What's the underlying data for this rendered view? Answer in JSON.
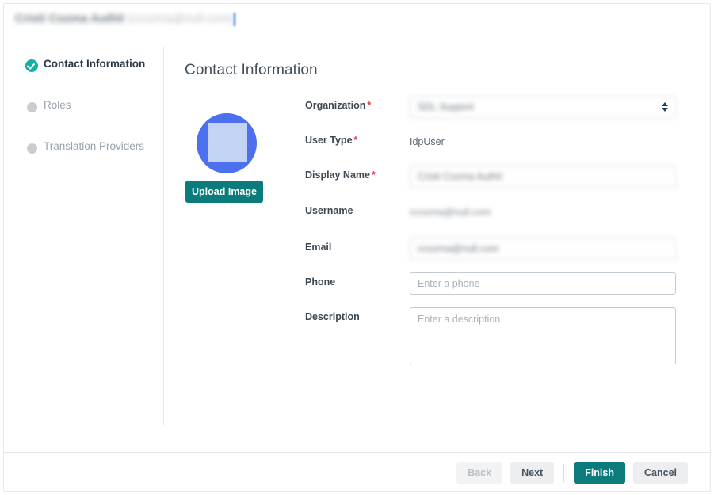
{
  "dialog": {
    "title_name": "Cristi Cozma Auth0",
    "title_email": "(ccozma@null.com)"
  },
  "stepper": {
    "steps": [
      {
        "label": "Contact Information",
        "state": "done"
      },
      {
        "label": "Roles",
        "state": "todo"
      },
      {
        "label": "Translation Providers",
        "state": "todo"
      }
    ]
  },
  "main": {
    "panel_title": "Contact Information",
    "avatar": {
      "upload_label": "Upload Image"
    },
    "form": {
      "organization": {
        "label": "Organization",
        "required": "*",
        "value": "SDL Support"
      },
      "user_type": {
        "label": "User Type",
        "required": "*",
        "value": "IdpUser"
      },
      "display_name": {
        "label": "Display Name",
        "required": "*",
        "value": "Cristi Cozma Auth0"
      },
      "username": {
        "label": "Username",
        "value": "ccozma@null.com"
      },
      "email": {
        "label": "Email",
        "value": "ccozma@null.com"
      },
      "phone": {
        "label": "Phone",
        "value": "",
        "placeholder": "Enter a phone"
      },
      "description": {
        "label": "Description",
        "value": "",
        "placeholder": "Enter a description"
      }
    }
  },
  "footer": {
    "back_label": "Back",
    "next_label": "Next",
    "finish_label": "Finish",
    "cancel_label": "Cancel"
  },
  "colors": {
    "primary_teal": "#0b7b7b",
    "step_done": "#13b0a5",
    "required_red": "#e8384f",
    "avatar_blue": "#4d70ee"
  }
}
